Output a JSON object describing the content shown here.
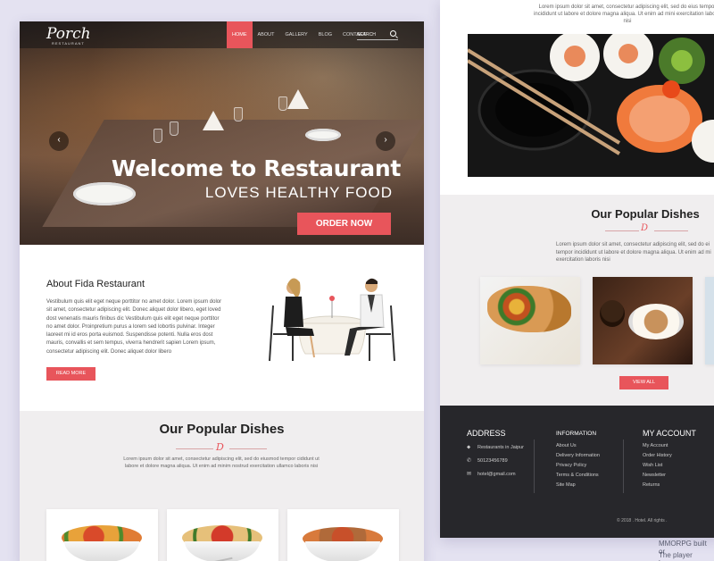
{
  "colors": {
    "accent": "#e8555b",
    "footer_bg": "#27272b",
    "section_bg": "#f0eeef",
    "background": "#e4e2f1"
  },
  "left_page": {
    "logo": "Porch",
    "logo_sub": "RESTAURANT",
    "nav": [
      {
        "label": "HOME",
        "active": true
      },
      {
        "label": "ABOUT",
        "active": false
      },
      {
        "label": "GALLERY",
        "active": false
      },
      {
        "label": "BLOG",
        "active": false
      },
      {
        "label": "CONTACT",
        "active": false
      }
    ],
    "search_label": "SEARCH",
    "hero": {
      "prev_icon": "chevron-left-icon",
      "next_icon": "chevron-right-icon",
      "prev_glyph": "‹",
      "next_glyph": "›",
      "title": "Welcome to Restaurant",
      "subtitle": "LOVES HEALTHY  FOOD",
      "cta": "ORDER NOW"
    },
    "about": {
      "title": "About Fida Restaurant",
      "text": "Vestibulum quis elit eget neque porttitor no amet dolor. Lorem ipsum dolor sit amet, consectetur adipiscing elit. Donec aliquet dolor libero, eget loved dost venenatis mauris finibus dic Vestibulum quis elit eget neque porttitor no amet dolor. Proinpretium purus a lorem sed lobortis pulvinar. Integer laoreet mi id eros porta euismod. Suspendisse potenti. Nulla eros dost mauris, convallis et sem tempus, viverra hendrerit sapien Lorem ipsum, consectetur adipiscing elit. Donec aliquet dolor libero",
      "button": "READ MORE"
    },
    "dishes": {
      "title": "Our Popular Dishes",
      "glyph": "D",
      "desc": "Lorem ipsum dolor sit amet, consectetur adipiscing elit, sed do eiusmod tempor cididunt ut labore et dolore magna aliqua. Ut enim ad minim nostrud exercitation ullamco laboris nisi"
    }
  },
  "right_page": {
    "top_text": "Lorem ipsum dolor sit amet, consectetur adipiscing elit, sed do eius tempor incididunt ut labore et dolore magna aliqua. Ut enim ad mini exercitation laboris nisi",
    "dishes": {
      "title": "Our Popular Dishes",
      "glyph": "D",
      "desc": "Lorem ipsum dolor sit amet, consectetur adipiscing elit, sed do ei tempor incididunt ut labore et dolore magna aliqua. Ut enim ad mi exercitation laboris nisi",
      "button": "VIEW ALL"
    },
    "footer": {
      "address": {
        "title": "ADDRESS",
        "lines": [
          {
            "icon": "map-pin-icon",
            "glyph": "⬥",
            "text": "Restaurants in Jaipur"
          },
          {
            "icon": "phone-icon",
            "glyph": "✆",
            "text": "50123456789"
          },
          {
            "icon": "mail-icon",
            "glyph": "✉",
            "text": "hotel@gmail.com"
          }
        ]
      },
      "information": {
        "title": "INFORMATION",
        "links": [
          "About Us",
          "Delivery Information",
          "Privacy Policy",
          "Terms & Conditions",
          "Site Map"
        ]
      },
      "account": {
        "title": "MY ACCOUNT",
        "links": [
          "My Account",
          "Order History",
          "Wish List",
          "Newsletter",
          "Returns"
        ]
      },
      "copyright": "© 2018 . Hotel. All rights ."
    }
  },
  "outside_text": [
    "MMORPG built or",
    "The player becom"
  ]
}
